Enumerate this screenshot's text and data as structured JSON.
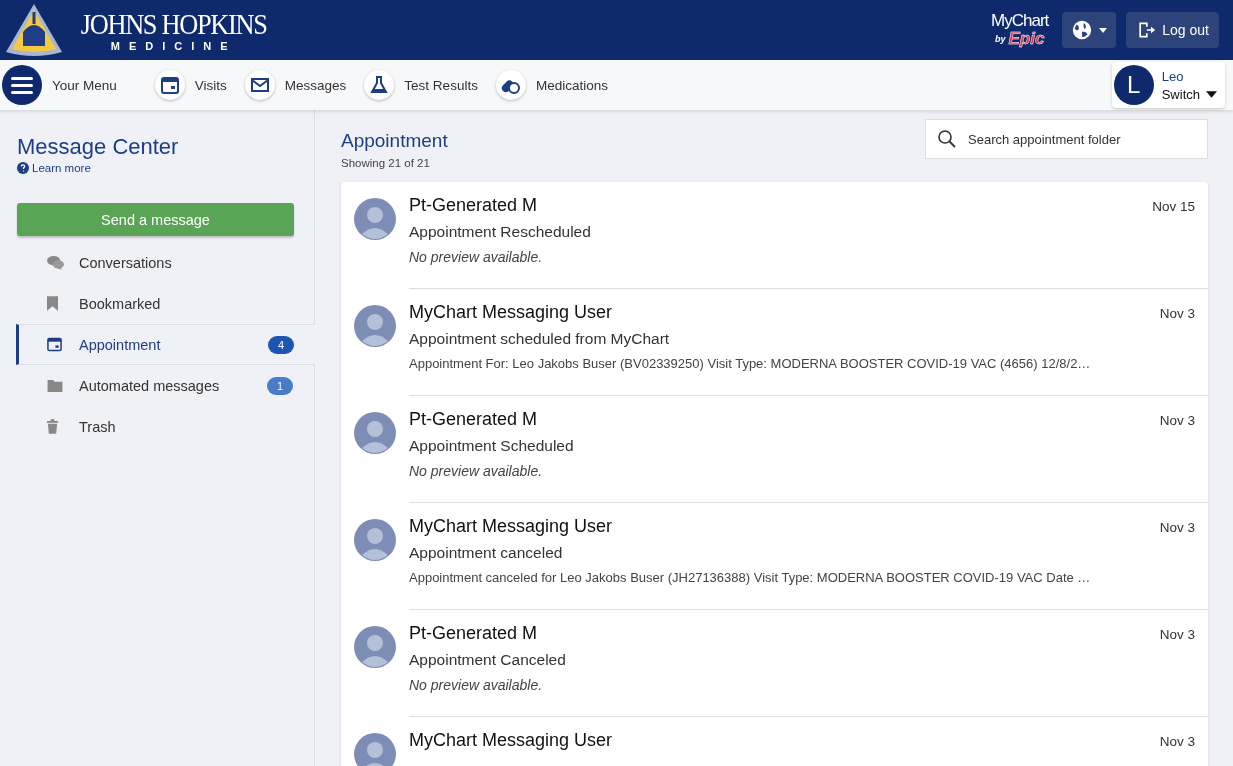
{
  "header": {
    "logo_title": "JOHNS HOPKINS",
    "logo_subtitle": "MEDICINE",
    "brand_name": "MyChart",
    "brand_by": "by",
    "brand_vendor": "Epic",
    "logout": "Log out"
  },
  "nav": {
    "menu": "Your Menu",
    "items": [
      {
        "label": "Visits"
      },
      {
        "label": "Messages"
      },
      {
        "label": "Test Results"
      },
      {
        "label": "Medications"
      }
    ],
    "user": {
      "initial": "L",
      "name": "Leo",
      "switch": "Switch"
    }
  },
  "sidebar": {
    "title": "Message Center",
    "help": "Learn more",
    "compose": "Send a message",
    "items": [
      {
        "label": "Conversations",
        "selected": false
      },
      {
        "label": "Bookmarked",
        "selected": false
      },
      {
        "label": "Appointment",
        "selected": true,
        "count": "4"
      },
      {
        "label": "Automated messages",
        "selected": false,
        "count": "1"
      },
      {
        "label": "Trash",
        "selected": false
      }
    ]
  },
  "folder": {
    "title": "Appointment",
    "showing": "Showing 21 of 21",
    "search": {
      "placeholder": "Search appointment folder"
    }
  },
  "messages": [
    {
      "sender": "Pt-Generated M",
      "date": "Nov 15",
      "subject": "Appointment Rescheduled",
      "preview": "No preview available.",
      "preview_available": false
    },
    {
      "sender": "MyChart Messaging User",
      "date": "Nov 3",
      "subject": "Appointment scheduled from MyChart",
      "preview": "Appointment For: Leo Jakobs Buser (BV02339250) Visit Type: MODERNA BOOSTER COVID-19 VAC (4656)   12/8/2…",
      "preview_available": true
    },
    {
      "sender": "Pt-Generated M",
      "date": "Nov 3",
      "subject": "Appointment Scheduled",
      "preview": "No preview available.",
      "preview_available": false
    },
    {
      "sender": "MyChart Messaging User",
      "date": "Nov 3",
      "subject": "Appointment canceled",
      "preview": "Appointment canceled for Leo Jakobs Buser (JH27136388) Visit Type: MODERNA BOOSTER COVID-19 VAC Date …",
      "preview_available": true
    },
    {
      "sender": "Pt-Generated M",
      "date": "Nov 3",
      "subject": "Appointment Canceled",
      "preview": "No preview available.",
      "preview_available": false
    },
    {
      "sender": "MyChart Messaging User",
      "date": "Nov 3"
    }
  ]
}
